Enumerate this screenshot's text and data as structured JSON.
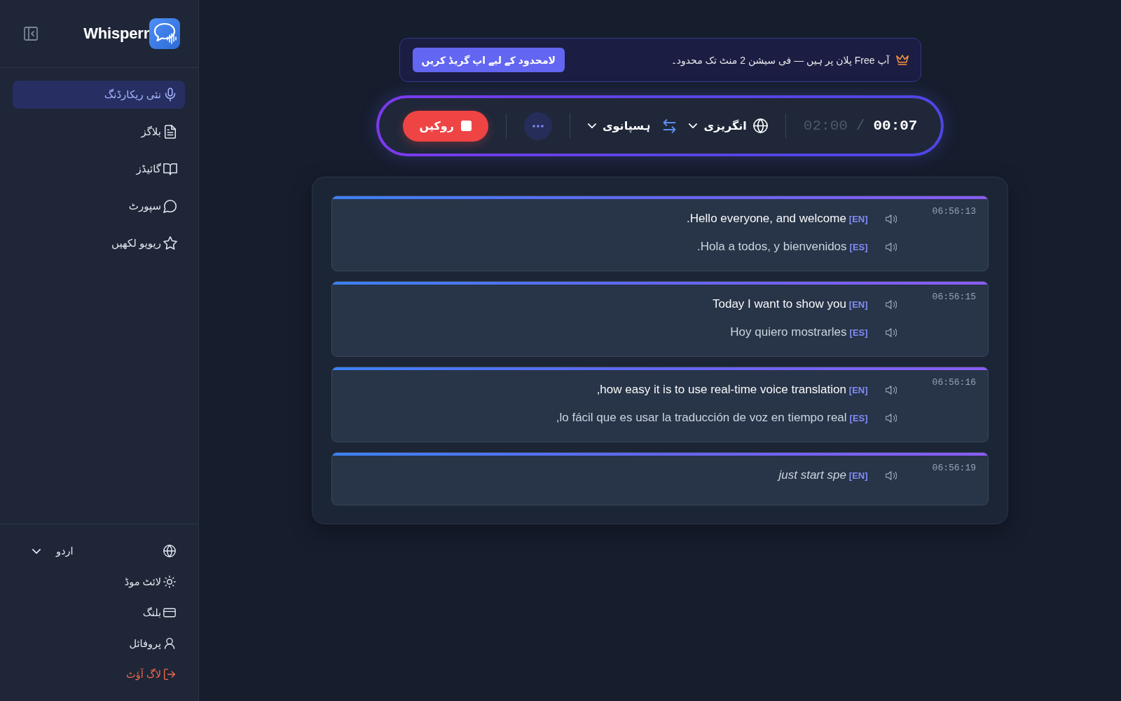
{
  "sidebar": {
    "logo_text": "Whisperr",
    "nav": [
      {
        "label": "نئی ریکارڈنگ",
        "kind": "recording",
        "selected": true
      },
      {
        "label": "بلاگز",
        "kind": "blogs",
        "selected": false
      },
      {
        "label": "گائیڈز",
        "kind": "guides",
        "selected": false
      },
      {
        "label": "سپورٹ",
        "kind": "support",
        "selected": false
      },
      {
        "label": "ریویو لکھیں",
        "kind": "review",
        "selected": false
      }
    ],
    "language_select": {
      "value": "اردو"
    },
    "footer": [
      {
        "label": "لائٹ موڈ",
        "kind": "theme"
      },
      {
        "label": "بلنگ",
        "kind": "billing"
      },
      {
        "label": "پروفائل",
        "kind": "profile"
      },
      {
        "label": "لاگ آؤٹ",
        "kind": "logout"
      }
    ]
  },
  "banner": {
    "text": "آپ Free پلان پر ہیں — فی سیشن 2 منٹ تک محدود۔",
    "button": "لامحدود کے لیے اپ گریڈ کریں"
  },
  "controls": {
    "elapsed": "00:07",
    "separator": "/",
    "limit": "02:00",
    "source_language": "انگریزی",
    "target_language": "ہسپانوی",
    "stop_button": "روکیں"
  },
  "transcript": [
    {
      "time": "06:56:13",
      "interim": false,
      "lines": [
        {
          "kind": "original",
          "tag": "[EN]",
          "text": "Hello everyone, and welcome."
        },
        {
          "kind": "translation",
          "tag": "[ES]",
          "text": "Hola a todos, y bienvenidos."
        }
      ]
    },
    {
      "time": "06:56:15",
      "interim": false,
      "lines": [
        {
          "kind": "original",
          "tag": "[EN]",
          "text": "Today I want to show you"
        },
        {
          "kind": "translation",
          "tag": "[ES]",
          "text": "Hoy quiero mostrarles"
        }
      ]
    },
    {
      "time": "06:56:16",
      "interim": false,
      "lines": [
        {
          "kind": "original",
          "tag": "[EN]",
          "text": "how easy it is to use real-time voice translation,"
        },
        {
          "kind": "translation",
          "tag": "[ES]",
          "text": "lo fácil que es usar la traducción de voz en tiempo real,"
        }
      ]
    },
    {
      "time": "06:56:19",
      "interim": true,
      "lines": [
        {
          "kind": "original",
          "tag": "[EN]",
          "text": "just start spe"
        }
      ]
    }
  ]
}
